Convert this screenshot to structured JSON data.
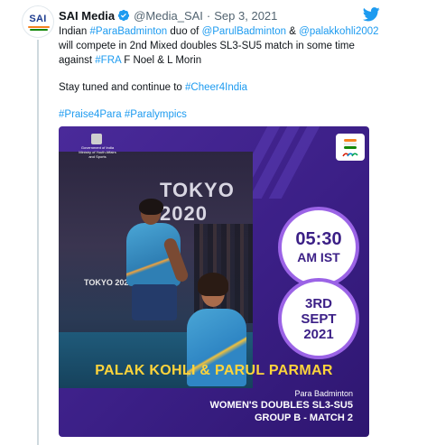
{
  "tweet": {
    "author_name": "SAI Media",
    "handle": "@Media_SAI",
    "separator": "·",
    "date": "Sep 3, 2021",
    "avatar_text": "SAI"
  },
  "body": {
    "line1": [
      {
        "t": "Indian ",
        "link": false
      },
      {
        "t": "#ParaBadminton",
        "link": true
      },
      {
        "t": " duo of ",
        "link": false
      },
      {
        "t": "@ParulBadminton",
        "link": true
      },
      {
        "t": " & ",
        "link": false
      },
      {
        "t": "@palakkohli2002",
        "link": true
      }
    ],
    "line2": "will compete in 2nd Mixed doubles SL3-SU5 match in some time",
    "line3": [
      {
        "t": "against ",
        "link": false
      },
      {
        "t": "#FRA",
        "link": true
      },
      {
        "t": " F Noel & L Morin",
        "link": false
      }
    ],
    "line4": [
      {
        "t": "Stay tuned and continue to ",
        "link": false
      },
      {
        "t": "#Cheer4India",
        "link": true
      }
    ],
    "line5": [
      {
        "t": "#Praise4Para",
        "link": true
      },
      {
        "t": " ",
        "link": false
      },
      {
        "t": "#Paralympics",
        "link": true
      }
    ]
  },
  "card": {
    "gov_line1": "Government of India",
    "gov_line2": "Ministry of Youth Affairs and Sports",
    "venue_sign": "TOKYO 2020",
    "venue_sign_small": "TOKYO 2020",
    "time_big": "05:30",
    "time_small": "AM IST",
    "date_line1": "3RD",
    "date_line2": "SEPT",
    "date_line3": "2021",
    "player_names": "PALAK KOHLI & PARUL PARMAR",
    "sport": "Para Badminton",
    "event_line1": "WOMEN'S DOUBLES SL3-SU5",
    "event_line2": "GROUP B - MATCH 2"
  },
  "colors": {
    "link": "#1d9bf0",
    "card_purple": "#3b1f86",
    "names_yellow": "#ffd43b",
    "twitter_blue": "#1d9bf0"
  },
  "icons": {
    "verified": "verified-badge-icon",
    "twitter": "twitter-bird-icon"
  }
}
